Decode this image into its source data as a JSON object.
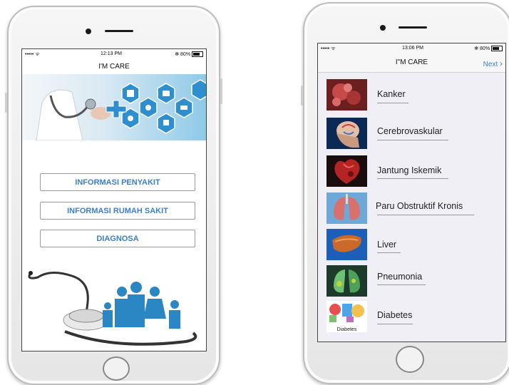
{
  "left_phone": {
    "status": {
      "carrier": "••••• ᯤ",
      "time": "12:13 PM",
      "battery": "✻ 80%"
    },
    "title": "I'M CARE",
    "menu": [
      {
        "label": "INFORMASI PENYAKIT"
      },
      {
        "label": "INFORMASI RUMAH SAKIT"
      },
      {
        "label": "DIAGNOSA"
      }
    ]
  },
  "right_phone": {
    "status": {
      "carrier": "••••• ᯤ",
      "time": "13:06 PM",
      "battery": "✻ 80%"
    },
    "title": "I\"M CARE",
    "next_label": "Next",
    "next_icon": "chevron-right-icon",
    "diseases": [
      {
        "label": "Kanker"
      },
      {
        "label": "Cerebrovaskular"
      },
      {
        "label": "Jantung Iskemik"
      },
      {
        "label": "Paru Obstruktif Kronis"
      },
      {
        "label": "Liver"
      },
      {
        "label": "Pneumonia"
      },
      {
        "label": "Diabetes",
        "thumb_caption": "Diabetes"
      }
    ]
  },
  "colors": {
    "accent": "#3a7fd2",
    "banner": "#5db7e0",
    "list_bg": "#f0eff5"
  }
}
